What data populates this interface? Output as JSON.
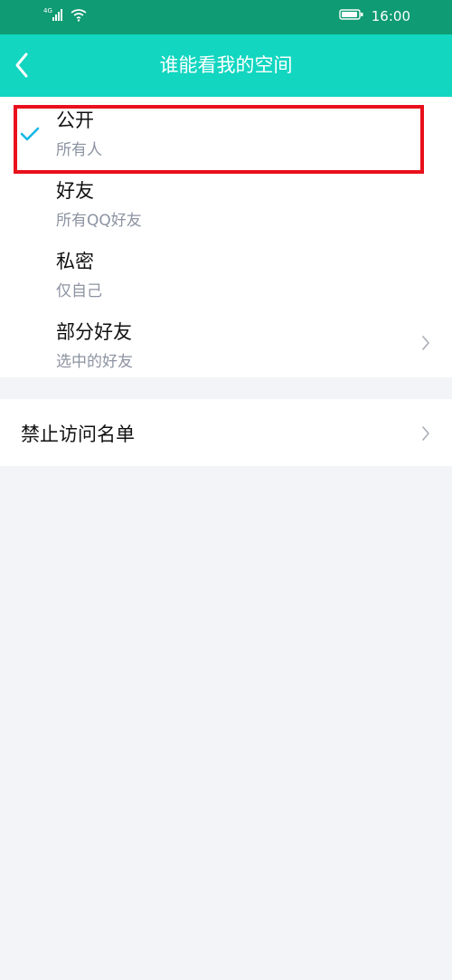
{
  "status": {
    "signal_label": "4G",
    "time": "16:00"
  },
  "nav": {
    "title": "谁能看我的空间"
  },
  "options": [
    {
      "title": "公开",
      "subtitle": "所有人",
      "selected": true
    },
    {
      "title": "好友",
      "subtitle": "所有QQ好友",
      "selected": false
    },
    {
      "title": "私密",
      "subtitle": "仅自己",
      "selected": false
    },
    {
      "title": "部分好友",
      "subtitle": "选中的好友",
      "selected": false
    }
  ],
  "block_list": {
    "label": "禁止访问名单"
  },
  "colors": {
    "status_bar": "#0f9b73",
    "nav_bar": "#12d6c0",
    "check": "#18b7e6",
    "highlight": "#e8101b",
    "background": "#f3f4f8"
  },
  "icons": [
    "signal-icon",
    "wifi-icon",
    "battery-icon",
    "back-arrow-icon",
    "check-icon",
    "chevron-right-icon"
  ]
}
